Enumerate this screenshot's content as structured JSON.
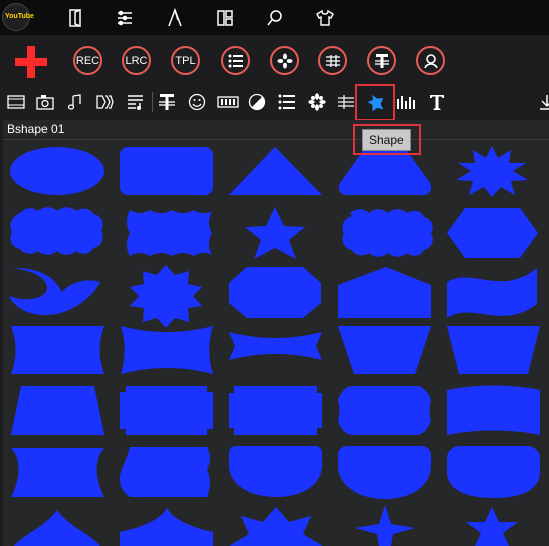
{
  "app": {
    "logo_text": "YouTube"
  },
  "top_icons": [
    "door-icon",
    "list-sliders-icon",
    "compass-icon",
    "layout-icon",
    "search-icon",
    "tshirt-icon"
  ],
  "main_toolbar": {
    "add_icon": "red-plus-icon",
    "buttons": [
      {
        "name": "rec-button",
        "label": "REC"
      },
      {
        "name": "lrc-button",
        "label": "LRC"
      },
      {
        "name": "tpl-button",
        "label": "TPL"
      },
      {
        "name": "list-button",
        "label": ""
      },
      {
        "name": "flower-button",
        "label": ""
      },
      {
        "name": "music-lines-button",
        "label": ""
      },
      {
        "name": "text-button",
        "label": ""
      },
      {
        "name": "person-button",
        "label": ""
      }
    ]
  },
  "sub_toolbar": {
    "icons": [
      "film-icon",
      "camera-icon",
      "music-note-icon",
      "transition-icon",
      "lyrics-icon",
      "text-lines-icon",
      "emoji-icon",
      "bar-meter-icon",
      "contrast-icon",
      "bullet-list-icon",
      "flower-icon",
      "music-staff-icon",
      "shape-icon",
      "equalizer-icon",
      "title-t-icon",
      "download-icon"
    ],
    "selected": "shape-icon"
  },
  "tooltip": {
    "text": "Shape"
  },
  "panel": {
    "title": "Bshape 01"
  },
  "colors": {
    "shape_fill": "#1a33ff",
    "highlight": "#e0333a",
    "accent": "#e85d55"
  },
  "shapes": [
    "ellipse",
    "rounded-rect",
    "triangle",
    "trapezoid",
    "starburst",
    "cloud",
    "scalloped",
    "star-5",
    "cloud-2",
    "hexagon",
    "crescent",
    "star-8",
    "octagon",
    "house",
    "wave-banner",
    "concave-rect",
    "bowtie",
    "ribbon",
    "inverted-trapezoid",
    "trapezoid-2",
    "trapezoid-3",
    "notched-rect",
    "notched-rect-2",
    "rounded-notch",
    "wavy-rect",
    "concave-diamond",
    "badge",
    "shield",
    "shield-2",
    "rounded-shield",
    "dome",
    "arch",
    "star-top",
    "sparkle",
    "star-small"
  ]
}
